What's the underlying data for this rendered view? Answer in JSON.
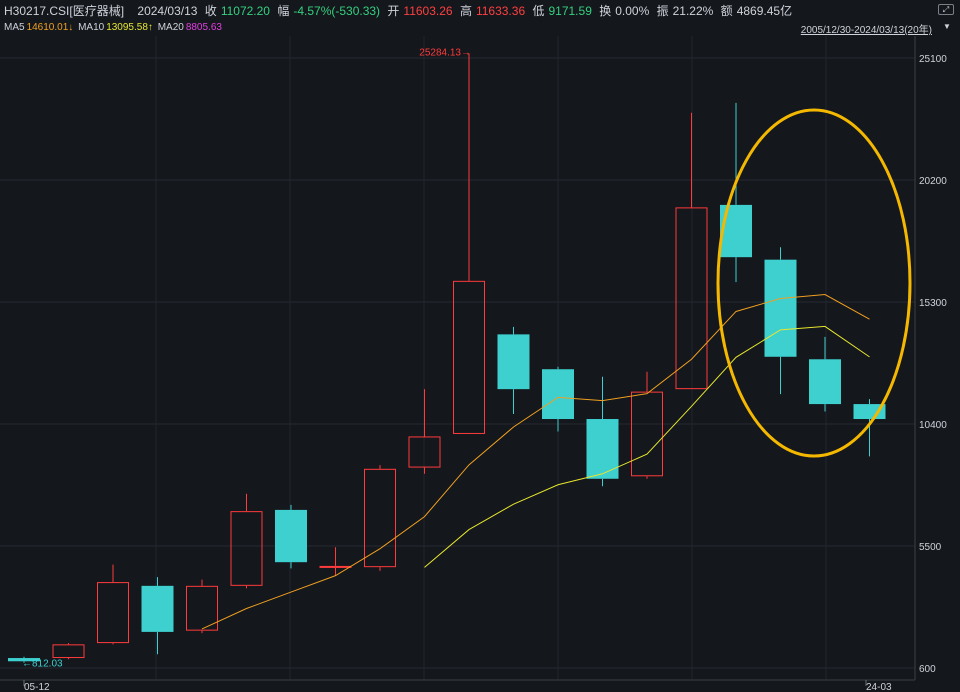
{
  "header": {
    "code": "H30217.CSI[医疗器械]",
    "date": "2024/03/13",
    "close_label": "收",
    "close": "11072.20",
    "change_label": "幅",
    "change": "-4.57%(-530.33)",
    "open_label": "开",
    "open": "11603.26",
    "high_label": "高",
    "high": "11633.36",
    "low_label": "低",
    "low": "9171.59",
    "turnover_label": "换",
    "turnover": "0.00%",
    "amplitude_label": "振",
    "amplitude": "21.22%",
    "amount_label": "额",
    "amount": "4869.45亿"
  },
  "ma": {
    "ma5_label": "MA5",
    "ma5": "14610.01↓",
    "ma10_label": "MA10",
    "ma10": "13095.58↑",
    "ma20_label": "MA20",
    "ma20": "8805.63"
  },
  "range_label": "2005/12/30-2024/03/13(20年)",
  "button_icons": [
    "expand-icon",
    "dropdown-triangle-icon"
  ],
  "colors": {
    "up": "#ff3b3b",
    "down": "#3ecfcf",
    "ma5": "#f0a020",
    "ma10": "#e6e62e",
    "ma20": "#e040e0",
    "highlight": "#f5b800"
  },
  "chart_data": {
    "type": "candlestick",
    "x_labels": [
      "05-12",
      "24-03"
    ],
    "y_ticks": [
      600,
      5500,
      10400,
      15300,
      20200,
      25100
    ],
    "ylim": [
      600,
      25100
    ],
    "annotations": [
      {
        "text": "25284.13→",
        "value": 25284.13
      },
      {
        "text": "←812.03",
        "value": 812.03
      }
    ],
    "candles": [
      {
        "open": 1000,
        "close": 870,
        "high": 1050,
        "low": 812
      },
      {
        "open": 1000,
        "close": 1550,
        "high": 1600,
        "low": 950
      },
      {
        "open": 1600,
        "close": 4050,
        "high": 4750,
        "low": 1550
      },
      {
        "open": 3900,
        "close": 2050,
        "high": 4250,
        "low": 1150
      },
      {
        "open": 2100,
        "close": 3900,
        "high": 4150,
        "low": 2000
      },
      {
        "open": 3900,
        "close": 6900,
        "high": 7600,
        "low": 3800
      },
      {
        "open": 6950,
        "close": 4850,
        "high": 7150,
        "low": 4600
      },
      {
        "open": 4650,
        "close": 4700,
        "high": 5450,
        "low": 4300
      },
      {
        "open": 4650,
        "close": 8600,
        "high": 8750,
        "low": 4500
      },
      {
        "open": 8650,
        "close": 9900,
        "high": 11800,
        "low": 8400
      },
      {
        "open": 10000,
        "close": 16150,
        "high": 25284.13,
        "low": 10000
      },
      {
        "open": 14000,
        "close": 11800,
        "high": 14300,
        "low": 10800
      },
      {
        "open": 12600,
        "close": 10600,
        "high": 12700,
        "low": 10100
      },
      {
        "open": 10600,
        "close": 8200,
        "high": 12300,
        "low": 7900
      },
      {
        "open": 8300,
        "close": 11700,
        "high": 12500,
        "low": 8200
      },
      {
        "open": 11800,
        "close": 19100,
        "high": 22900,
        "low": 11800
      },
      {
        "open": 19200,
        "close": 17100,
        "high": 23300,
        "low": 16100
      },
      {
        "open": 17000,
        "close": 13100,
        "high": 17500,
        "low": 11600
      },
      {
        "open": 13000,
        "close": 11200,
        "high": 13900,
        "low": 10900
      },
      {
        "open": 11200,
        "close": 10600,
        "high": 11400,
        "low": 9100
      }
    ],
    "ma5": [
      null,
      null,
      null,
      null,
      2170,
      2990,
      3650,
      4310,
      5390,
      6680,
      8760,
      10280,
      11470,
      11340,
      11620,
      13000,
      14920,
      15440,
      15600,
      14610
    ],
    "ma10": [
      null,
      null,
      null,
      null,
      null,
      null,
      null,
      null,
      null,
      4640,
      6160,
      7180,
      7960,
      8400,
      9190,
      11110,
      13080,
      14180,
      14320,
      13096
    ]
  }
}
